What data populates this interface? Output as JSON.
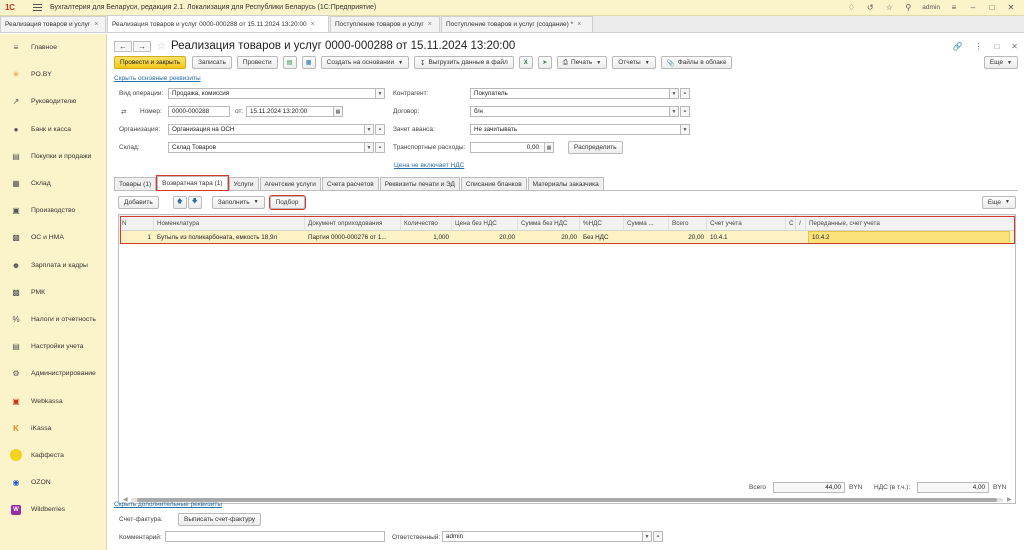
{
  "app": {
    "title": "Бухгалтерия для Беларуси, редакция 2.1. Локализация для Республики Беларусь   (1С:Предприятие)",
    "user": "admin",
    "logo": "1С"
  },
  "window_tabs": [
    {
      "label": "Реализация товаров и услуг",
      "active": false
    },
    {
      "label": "Реализация товаров и услуг 0000-000288 от 15.11.2024 13:20:00",
      "active": true
    },
    {
      "label": "Поступление товаров и услуг",
      "active": false
    },
    {
      "label": "Поступление товаров и услуг (создание) *",
      "active": false
    }
  ],
  "sidebar": {
    "items": [
      {
        "label": "Главное",
        "icon": "menu-icon"
      },
      {
        "label": "PO.BY",
        "icon": "sun-icon"
      },
      {
        "label": "Руководителю",
        "icon": "chart-line-icon"
      },
      {
        "label": "Банк и касса",
        "icon": "coin-icon"
      },
      {
        "label": "Покупки и продажи",
        "icon": "cart-icon"
      },
      {
        "label": "Склад",
        "icon": "warehouse-icon"
      },
      {
        "label": "Производство",
        "icon": "factory-icon"
      },
      {
        "label": "ОС и НМА",
        "icon": "truck-icon"
      },
      {
        "label": "Зарплата и кадры",
        "icon": "person-icon"
      },
      {
        "label": "РМК",
        "icon": "cash-register-icon"
      },
      {
        "label": "Налоги и отчетность",
        "icon": "percent-icon"
      },
      {
        "label": "Настройки учета",
        "icon": "ledger-icon"
      },
      {
        "label": "Администрирование",
        "icon": "gear-icon"
      },
      {
        "label": "Webkassa",
        "icon": "webkassa-icon"
      },
      {
        "label": "iKassa",
        "icon": "ikassa-icon"
      },
      {
        "label": "Каффеста",
        "icon": "kaffesta-icon"
      },
      {
        "label": "OZON",
        "icon": "ozon-icon"
      },
      {
        "label": "Wildberries",
        "icon": "wildberries-icon"
      }
    ]
  },
  "document": {
    "title": "Реализация товаров и услуг 0000-000288 от 15.11.2024 13:20:00"
  },
  "toolbar": {
    "post_close": "Провести и закрыть",
    "save": "Записать",
    "post": "Провести",
    "create_based_on": "Создать на основании",
    "export_file": "Выгрузить данные в файл",
    "print": "Печать",
    "reports": "Отчеты",
    "cloud_files": "Файлы в облаке",
    "more": "Еще"
  },
  "links": {
    "hide_main": "Скрыть основные реквизиты",
    "price_vat": "Цена не включает НДС",
    "show_additional": "Скрыть дополнительные реквизиты"
  },
  "form": {
    "operation_label": "Вид операции:",
    "operation_value": "Продажа, комиссия",
    "number_label": "Номер:",
    "number_value": "0000-000288",
    "date_label": "от:",
    "date_value": "15.11.2024 13:20:00",
    "org_label": "Организация:",
    "org_value": "Организация на ОСН",
    "warehouse_label": "Склад:",
    "warehouse_value": "Склад Товаров",
    "counterparty_label": "Контрагент:",
    "counterparty_value": "Покупатель",
    "contract_label": "Договор:",
    "contract_value": "б/н",
    "advance_label": "Зачет аванса:",
    "advance_value": "Не зачитывать",
    "transport_label": "Транспортные расходы:",
    "transport_value": "0,00",
    "distribute": "Распределить"
  },
  "doc_tabs": [
    {
      "label": "Товары (1)",
      "active": false,
      "highlighted": false
    },
    {
      "label": "Возвратная тара (1)",
      "active": true,
      "highlighted": true
    },
    {
      "label": "Услуги",
      "active": false,
      "highlighted": false
    },
    {
      "label": "Агентские услуги",
      "active": false,
      "highlighted": false
    },
    {
      "label": "Счета расчетов",
      "active": false,
      "highlighted": false
    },
    {
      "label": "Реквизиты печати и ЭД",
      "active": false,
      "highlighted": false
    },
    {
      "label": "Списание бланков",
      "active": false,
      "highlighted": false
    },
    {
      "label": "Материалы заказчика",
      "active": false,
      "highlighted": false
    }
  ],
  "grid_toolbar": {
    "add": "Добавить",
    "fill": "Заполнить",
    "pick": "Подбор",
    "more": "Еще"
  },
  "table": {
    "columns": [
      "N",
      "Номенклатура",
      "Документ оприходования",
      "Количество",
      "Цена без НДС",
      "Сумма без НДС",
      "%НДС",
      "Сумма ...",
      "Всего",
      "Счет учета",
      "С",
      "Переданные, счет учета"
    ],
    "rows": [
      {
        "n": "1",
        "item": "Бутыль из поликарбоната, емкость 18,9л",
        "doc": "Партия 0000-000276 от 1...",
        "qty": "1,000",
        "price": "20,00",
        "sum": "20,00",
        "vat_rate": "Без НДС",
        "vat_sum": "",
        "total": "20,00",
        "account": "10.4.1",
        "transferred_account": "10.4.2"
      }
    ]
  },
  "totals": {
    "total_label": "Всего",
    "total_value": "44,00",
    "currency": "BYN",
    "vat_label": "НДС (в т.ч.):",
    "vat_value": "4,00"
  },
  "footer": {
    "invoice_label": "Счет-фактура:",
    "invoice_button": "Выписать счет-фактуру",
    "comment_label": "Комментарий:",
    "comment_value": "",
    "responsible_label": "Ответственный:",
    "responsible_value": "admin"
  },
  "colors": {
    "accent": "#f2c81c",
    "sidebar_bg": "#fbf3c9",
    "highlight_red": "#d43a2c",
    "link": "#2a6ea6",
    "row_selected": "#fcf2c4"
  }
}
